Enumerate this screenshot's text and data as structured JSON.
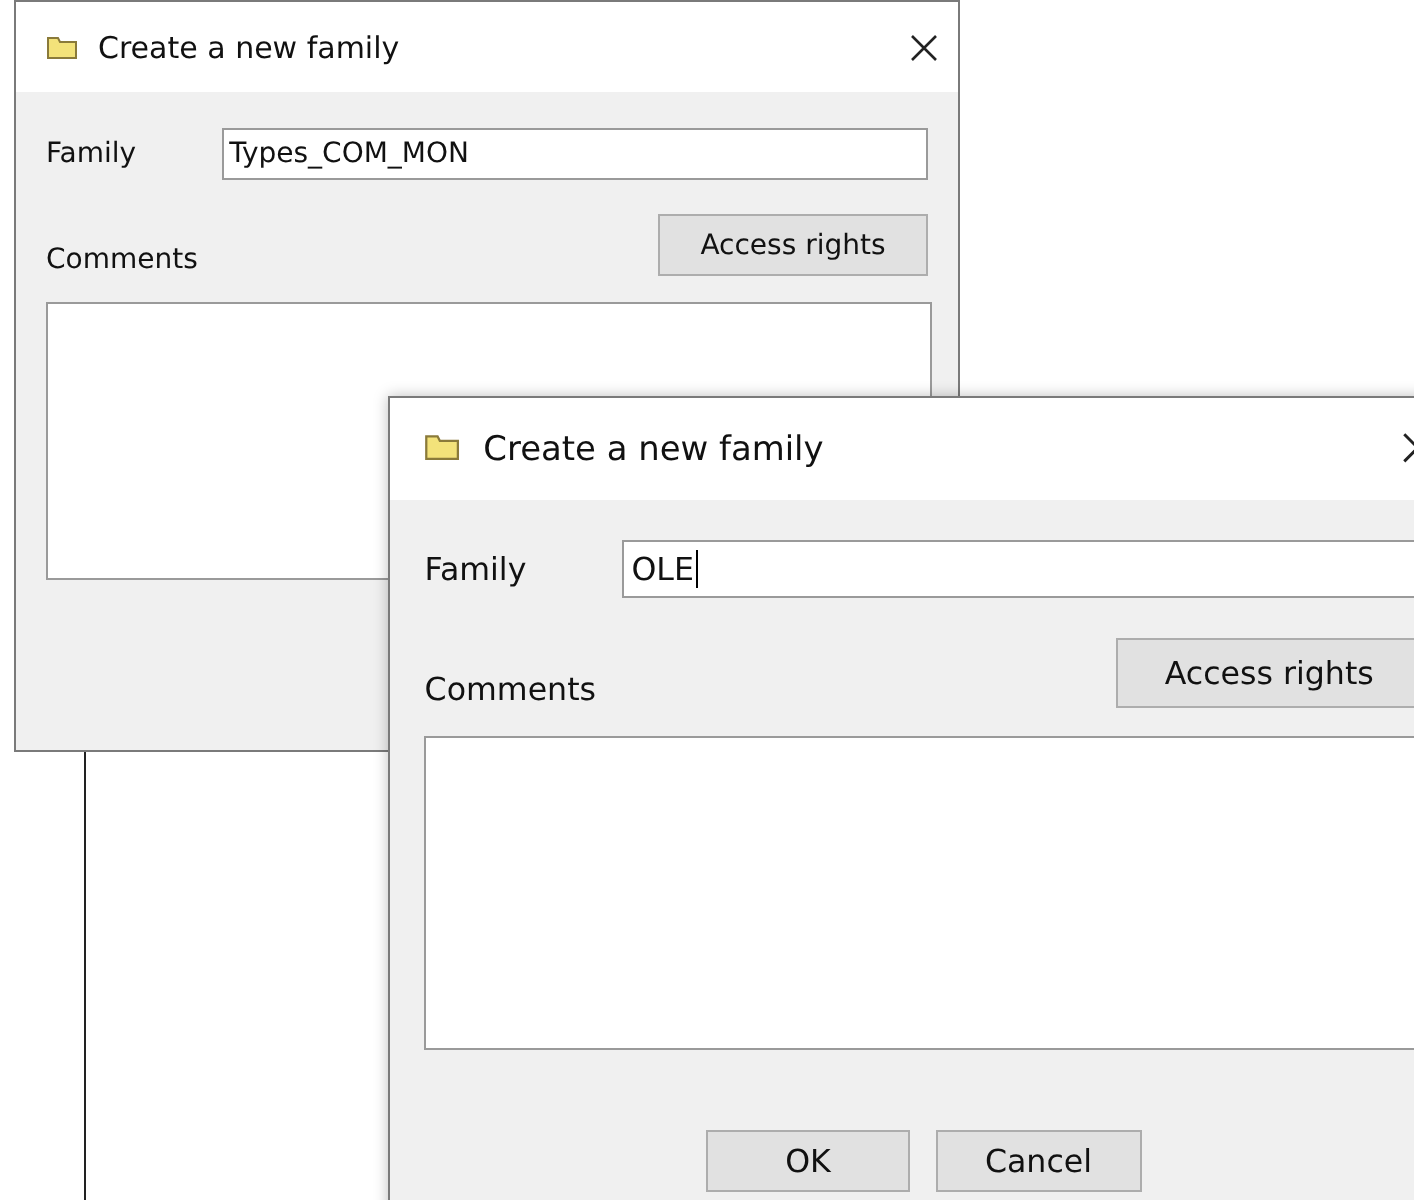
{
  "dialogs": [
    {
      "title": "Create a new family",
      "family_label": "Family",
      "family_value": "Types_COM_MON",
      "focused": false,
      "comments_label": "Comments",
      "access_button": "Access rights",
      "front": false
    },
    {
      "title": "Create a new family",
      "family_label": "Family",
      "family_value": "OLE",
      "focused": true,
      "comments_label": "Comments",
      "access_button": "Access rights",
      "front": true,
      "buttons": [
        "OK",
        "Cancel"
      ]
    }
  ]
}
